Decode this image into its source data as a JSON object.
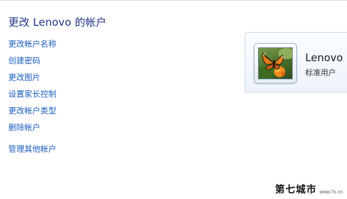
{
  "page": {
    "title": "更改 Lenovo 的帐户"
  },
  "tasks": [
    {
      "label": "更改帐户名称"
    },
    {
      "label": "创建密码"
    },
    {
      "label": "更改图片"
    },
    {
      "label": "设置家长控制"
    },
    {
      "label": "更改帐户类型"
    },
    {
      "label": "删除帐户"
    },
    {
      "label": "管理其他帐户"
    }
  ],
  "user_card": {
    "name": "Lenovo",
    "account_type": "标准用户",
    "avatar_icon": "butterfly-avatar"
  },
  "watermark": {
    "text": "第七城市",
    "url": "www.7c.cn"
  },
  "colors": {
    "title": "#1e3287",
    "link": "#1a5dbd",
    "card_border": "#c9d9e9"
  }
}
